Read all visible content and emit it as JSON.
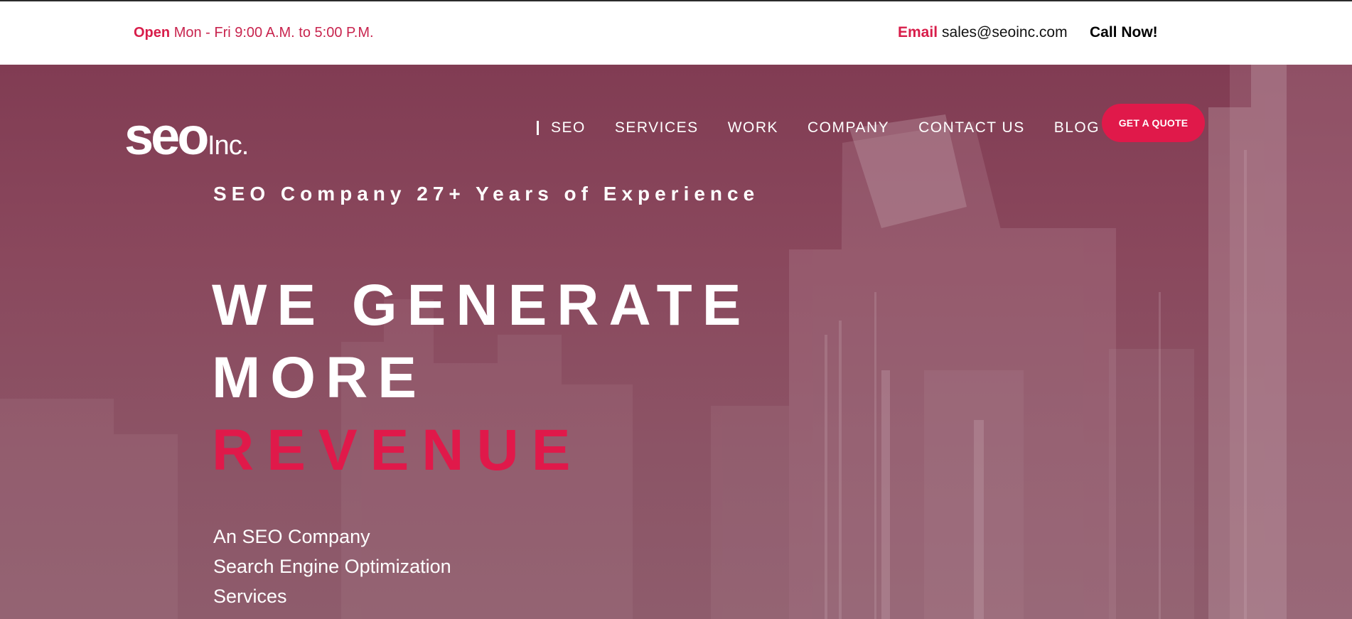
{
  "topbar": {
    "hours_label": "Open",
    "hours_text": "Mon - Fri 9:00 A.M. to 5:00 P.M.",
    "email_label": "Email",
    "email": "sales@seoinc.com",
    "call": "Call Now!"
  },
  "brand": {
    "logo_text": "seo",
    "logo_suffix": "Inc."
  },
  "nav": {
    "items": [
      {
        "label": "SEO"
      },
      {
        "label": "SERVICES"
      },
      {
        "label": "WORK"
      },
      {
        "label": "COMPANY"
      },
      {
        "label": "CONTACT US"
      },
      {
        "label": "BLOG"
      }
    ],
    "cta": "GET A QUOTE"
  },
  "hero": {
    "eyebrow": "SEO Company 27+ Years of Experience",
    "headline_line1": "WE GENERATE",
    "headline_line2": "MORE",
    "headline_line3": "REVENUE",
    "sub_line1": "An  SEO Company",
    "sub_line2": "Search Engine Optimization",
    "sub_line3": "Services"
  },
  "colors": {
    "accent": "#e0194a",
    "hero_overlay": "#813c53",
    "topbar_bg": "#ffffff"
  }
}
